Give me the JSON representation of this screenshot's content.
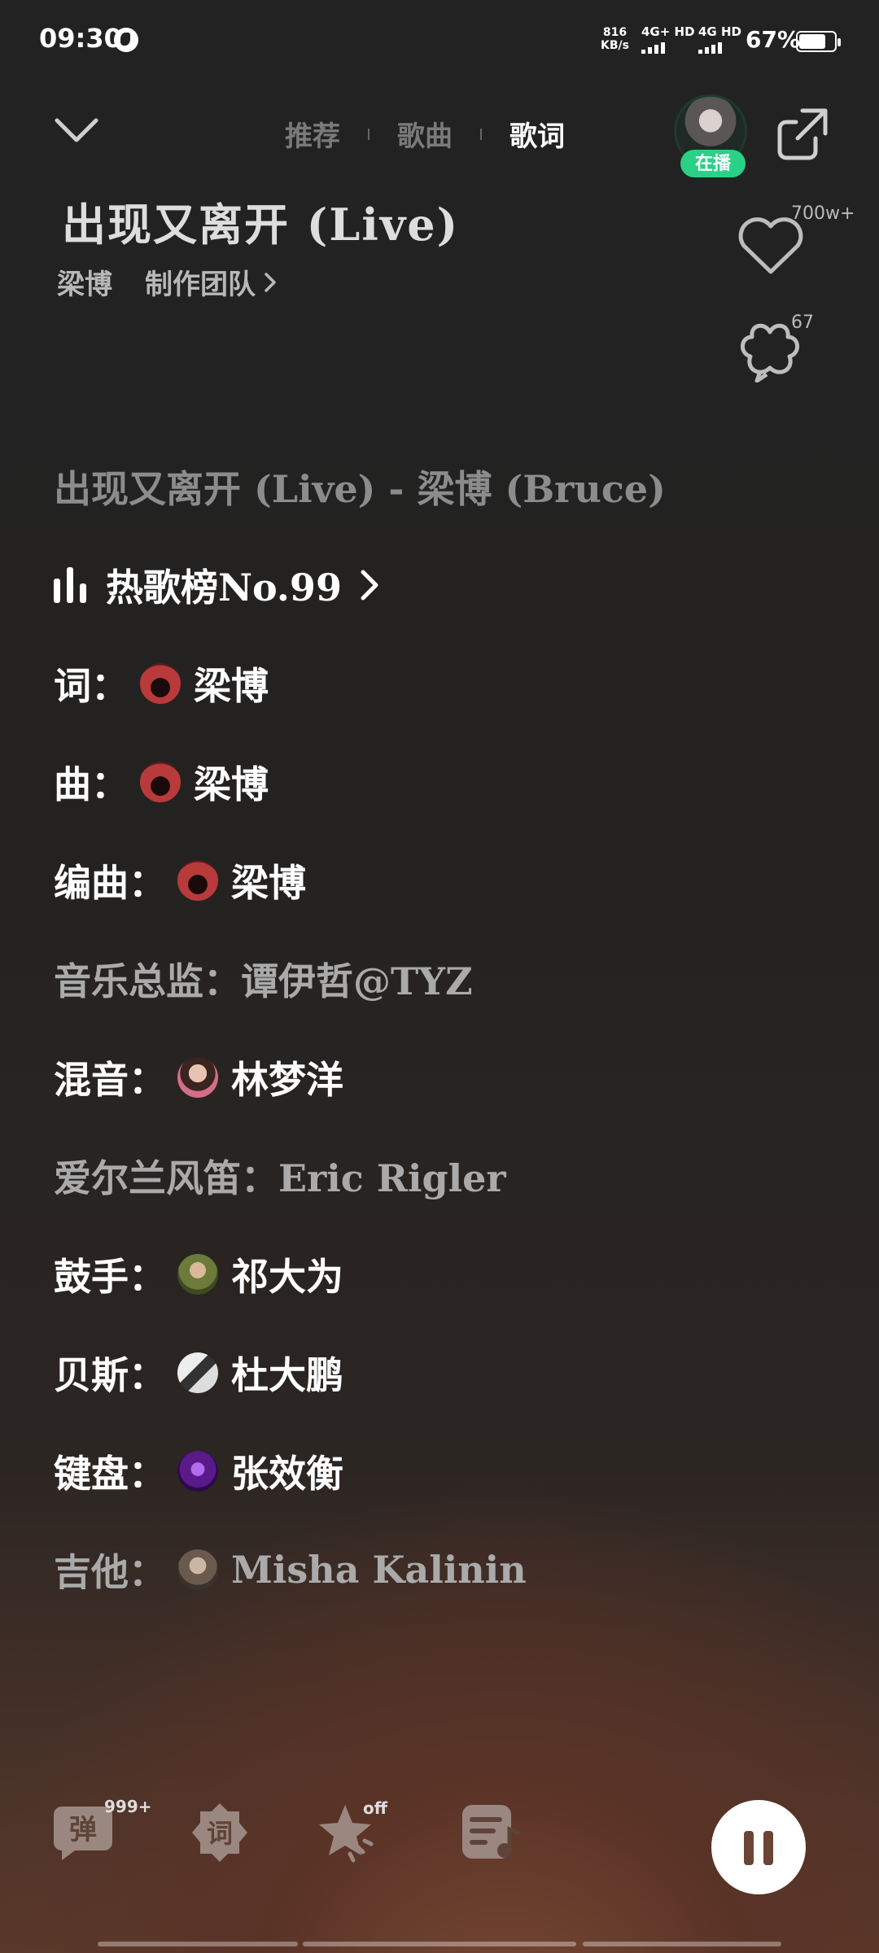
{
  "status_bar": {
    "time": "09:30",
    "net_speed_value": "816",
    "net_speed_unit": "KB/s",
    "network_1": "4G+ HD",
    "network_2": "4G HD",
    "battery": "67%"
  },
  "header": {
    "tabs": [
      "推荐",
      "歌曲",
      "歌词"
    ],
    "active_tab": "歌词",
    "playing_badge": "在播"
  },
  "song": {
    "title": "出现又离开 (Live)",
    "artist": "梁博",
    "team_link": "制作团队",
    "like_count": "700w+",
    "comment_count": "67"
  },
  "lyrics": {
    "heading": "出现又离开 (Live) - 梁博 (Bruce)",
    "chart_rank": "热歌榜No.99",
    "credits": [
      {
        "role": "词：",
        "name": "梁博"
      },
      {
        "role": "曲：",
        "name": "梁博"
      },
      {
        "role": "编曲：",
        "name": "梁博"
      },
      {
        "role": "",
        "name": "音乐总监：谭伊哲@TYZ"
      },
      {
        "role": "混音：",
        "name": "林梦洋"
      },
      {
        "role": "",
        "name": "爱尔兰风笛：Eric Rigler"
      },
      {
        "role": "鼓手：",
        "name": "祁大为"
      },
      {
        "role": "贝斯：",
        "name": "杜大鹏"
      },
      {
        "role": "键盘：",
        "name": "张效衡"
      },
      {
        "role": "吉他：",
        "name": "Misha Kalinin"
      }
    ]
  },
  "bottom": {
    "danmaku_label": "弹",
    "danmaku_count": "999+",
    "lyrics_label": "词",
    "effect_state": "off"
  }
}
